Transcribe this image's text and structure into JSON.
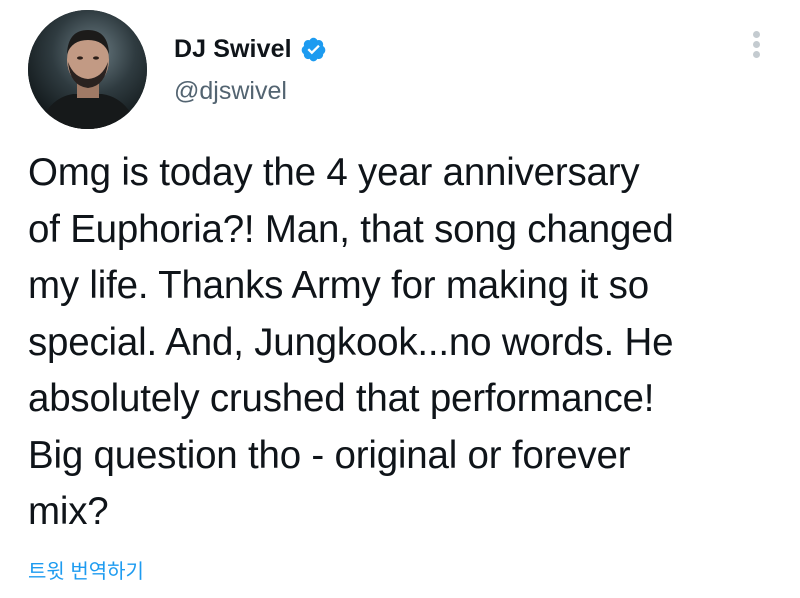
{
  "tweet": {
    "author": {
      "display_name": "DJ Swivel",
      "handle": "@djswivel",
      "verified": true
    },
    "text_lines": [
      "Omg is today the 4 year anniversary",
      "of Euphoria?! Man, that song changed",
      "my life. Thanks Army for making it so",
      "special. And, Jungkook...no words. He",
      "absolutely crushed that performance!",
      "Big question tho - original or forever",
      "mix?"
    ],
    "translate_label": "트윗 번역하기"
  },
  "icons": {
    "verified": "verified-badge-icon",
    "more": "more-options-icon"
  },
  "colors": {
    "accent": "#1d9bf0",
    "text": "#0f1419",
    "secondary_text": "#536471"
  }
}
